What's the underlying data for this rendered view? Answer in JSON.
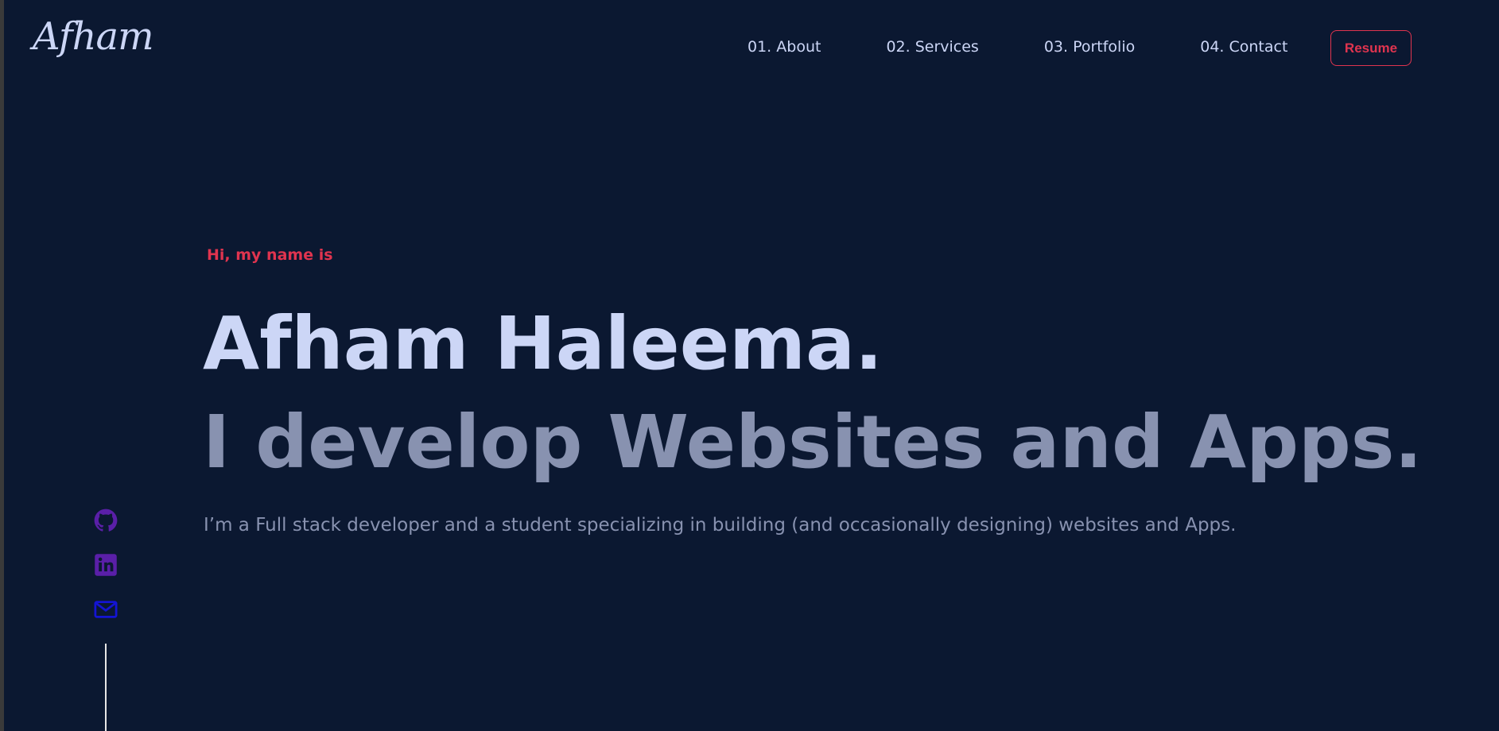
{
  "logo": {
    "text": "Afham"
  },
  "nav": {
    "items": [
      {
        "label": "01. About"
      },
      {
        "label": "02. Services"
      },
      {
        "label": "03. Portfolio"
      },
      {
        "label": "04. Contact"
      }
    ],
    "resume_label": "Resume"
  },
  "hero": {
    "intro": "Hi, my name is",
    "name": "Afham Haleema.",
    "tagline": "I develop Websites and Apps.",
    "description": "I’m a Full stack developer and a student specializing in building (and occasionally designing) websites and Apps."
  },
  "social": {
    "icons": [
      "github-icon",
      "linkedin-icon",
      "mail-icon"
    ]
  },
  "colors": {
    "background": "#0b1831",
    "accent": "#e0344f",
    "primary_text": "#ccd6f6",
    "secondary_text": "#8892b0",
    "social_icon_purple": "#5a1fa8",
    "social_icon_blue": "#1414d4"
  }
}
